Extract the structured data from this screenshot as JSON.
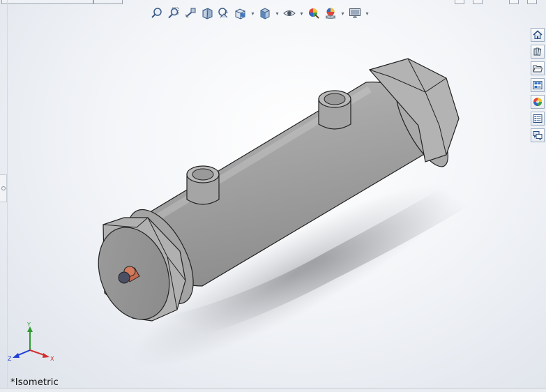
{
  "hud_toolbar": {
    "items": [
      {
        "icon": "zoom-to-fit-icon"
      },
      {
        "icon": "zoom-to-area-icon"
      },
      {
        "icon": "previous-view-icon"
      },
      {
        "icon": "section-view-icon"
      },
      {
        "icon": "dynamic-annotation-view-icon"
      },
      {
        "icon": "view-orientation-icon",
        "dropdown": true
      },
      {
        "icon": "display-style-icon",
        "dropdown": true
      },
      {
        "icon": "hide-show-items-icon",
        "dropdown": true
      },
      {
        "icon": "edit-appearance-icon"
      },
      {
        "icon": "apply-scene-icon",
        "dropdown": true
      },
      {
        "icon": "view-settings-icon",
        "dropdown": true
      }
    ]
  },
  "task_pane": {
    "items": [
      {
        "icon": "home-icon"
      },
      {
        "icon": "design-library-icon"
      },
      {
        "icon": "file-explorer-icon"
      },
      {
        "icon": "view-palette-icon"
      },
      {
        "icon": "appearances-scenes-icon"
      },
      {
        "icon": "custom-properties-icon"
      },
      {
        "icon": "forum-icon"
      }
    ]
  },
  "triad": {
    "x_label": "X",
    "y_label": "Y",
    "z_label": "Z",
    "x_color": "#d32f2f",
    "y_color": "#2e9b2e",
    "z_color": "#1f3fd6"
  },
  "view": {
    "orientation_label": "*Isometric"
  },
  "colors": {
    "body": "#a9a9a9",
    "body_light": "#c6c6c6",
    "body_dark": "#7d7d7d",
    "pin": "#c86a4e"
  }
}
